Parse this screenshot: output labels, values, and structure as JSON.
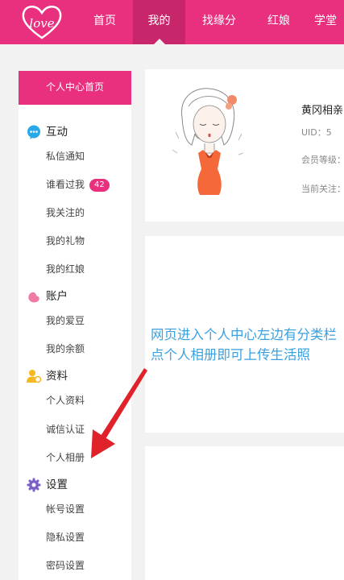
{
  "header": {
    "logo_text": "love",
    "nav": [
      {
        "label": "首页"
      },
      {
        "label": "我的"
      },
      {
        "label": "找缘分"
      },
      {
        "label": "红娘"
      },
      {
        "label": "学堂"
      }
    ]
  },
  "sidebar": {
    "home_label": "个人中心首页",
    "sections": [
      {
        "title": "互动",
        "icon": "chat-bubble-icon",
        "items": [
          {
            "label": "私信通知"
          },
          {
            "label": "谁看过我",
            "badge": "42"
          },
          {
            "label": "我关注的"
          },
          {
            "label": "我的礼物"
          },
          {
            "label": "我的红娘"
          }
        ]
      },
      {
        "title": "账户",
        "icon": "bean-icon",
        "items": [
          {
            "label": "我的爱豆"
          },
          {
            "label": "我的余额"
          }
        ]
      },
      {
        "title": "资料",
        "icon": "profile-person-icon",
        "items": [
          {
            "label": "个人资料"
          },
          {
            "label": "诚信认证"
          },
          {
            "label": "个人相册"
          }
        ]
      },
      {
        "title": "设置",
        "icon": "gear-icon",
        "items": [
          {
            "label": "帐号设置"
          },
          {
            "label": "隐私设置"
          },
          {
            "label": "密码设置"
          }
        ]
      }
    ]
  },
  "profile": {
    "name": "黄冈相亲",
    "uid": "UID：5",
    "level": "会员等级：",
    "following": "当前关注："
  },
  "annotation": {
    "text": "网页进入个人中心左边有分类栏点个人相册即可上传生活照"
  },
  "colors": {
    "brand_pink": "#e8307f",
    "active_nav": "#c7266b",
    "annotation_blue": "#3aa0e0",
    "arrow_red": "#e0222b"
  }
}
